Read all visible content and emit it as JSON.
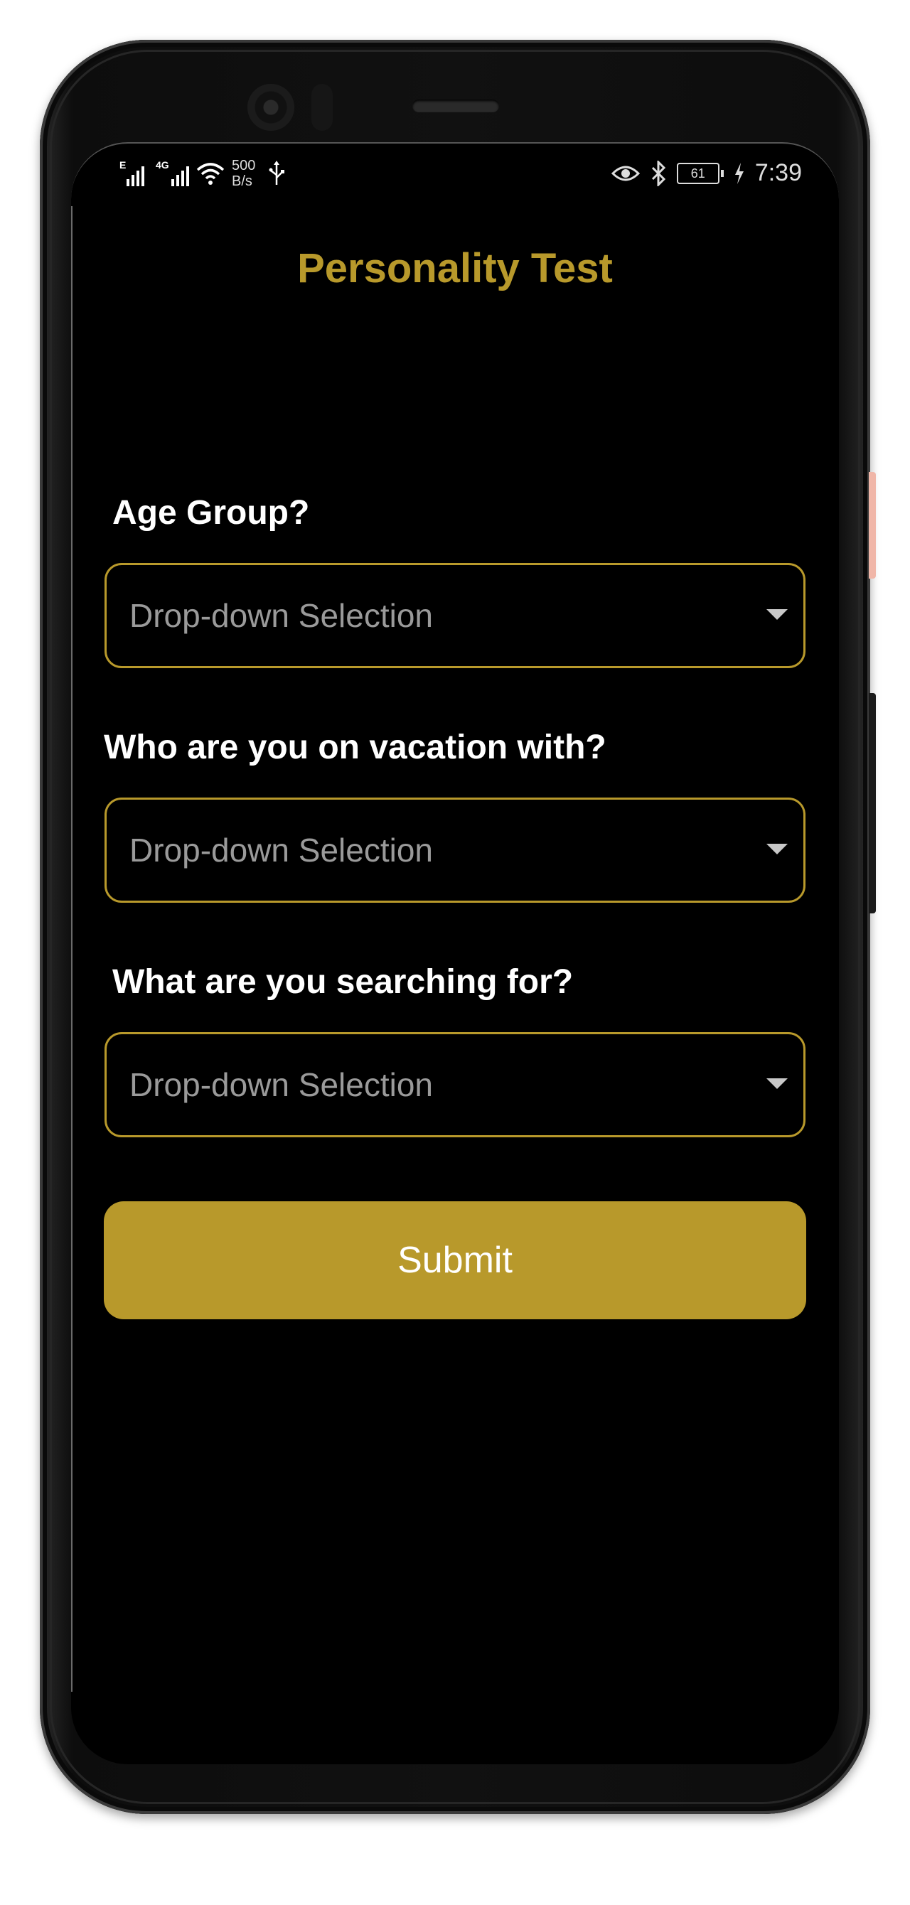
{
  "status_bar": {
    "signal1_tag": "E",
    "signal2_tag": "4G",
    "net_speed_value": "500",
    "net_speed_unit": "B/s",
    "battery_level": "61",
    "time": "7:39"
  },
  "app": {
    "title": "Personality Test",
    "accent_color": "#b8992b"
  },
  "questions": [
    {
      "label": "Age Group?",
      "placeholder": "Drop-down Selection"
    },
    {
      "label": "Who are you on vacation with?",
      "placeholder": "Drop-down Selection"
    },
    {
      "label": "What are you searching for?",
      "placeholder": "Drop-down Selection"
    }
  ],
  "submit_label": "Submit",
  "icons": {
    "wifi": "wifi-icon",
    "usb": "usb-icon",
    "eye": "eye-comfort-icon",
    "bluetooth": "bluetooth-icon",
    "charging": "charging-icon",
    "dropdown": "chevron-down-icon"
  }
}
